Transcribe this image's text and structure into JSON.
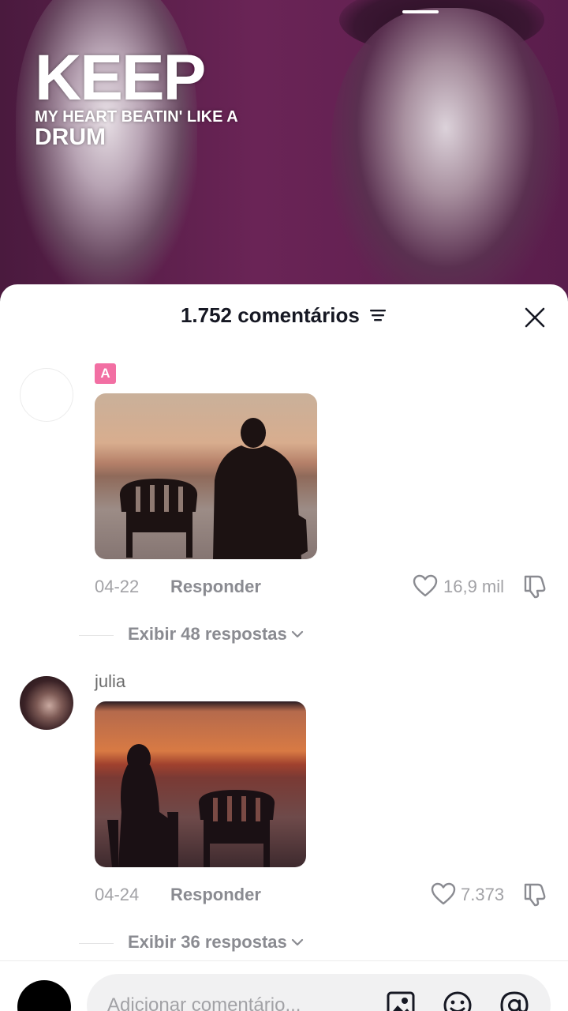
{
  "video": {
    "lyric_line1": "KEEP",
    "lyric_line2": "MY HEART BEATIN' LIKE A",
    "lyric_line3": "DRUM"
  },
  "comments_panel": {
    "title": "1.752 comentários",
    "close_icon": "close-icon",
    "filter_icon": "filter-icon"
  },
  "comments": [
    {
      "username": "",
      "badge": "A",
      "date": "04-22",
      "reply_label": "Responder",
      "likes": "16,9 mil",
      "replies_label": "Exibir 48 respostas"
    },
    {
      "username": "julia",
      "date": "04-24",
      "reply_label": "Responder",
      "likes": "7.373",
      "replies_label": "Exibir 36 respostas"
    }
  ],
  "input": {
    "placeholder": "Adicionar comentário..."
  },
  "colors": {
    "text_primary": "#161823",
    "text_secondary": "#8a8b91",
    "badge": "#f26fa3",
    "video_tint": "#6a2456"
  }
}
